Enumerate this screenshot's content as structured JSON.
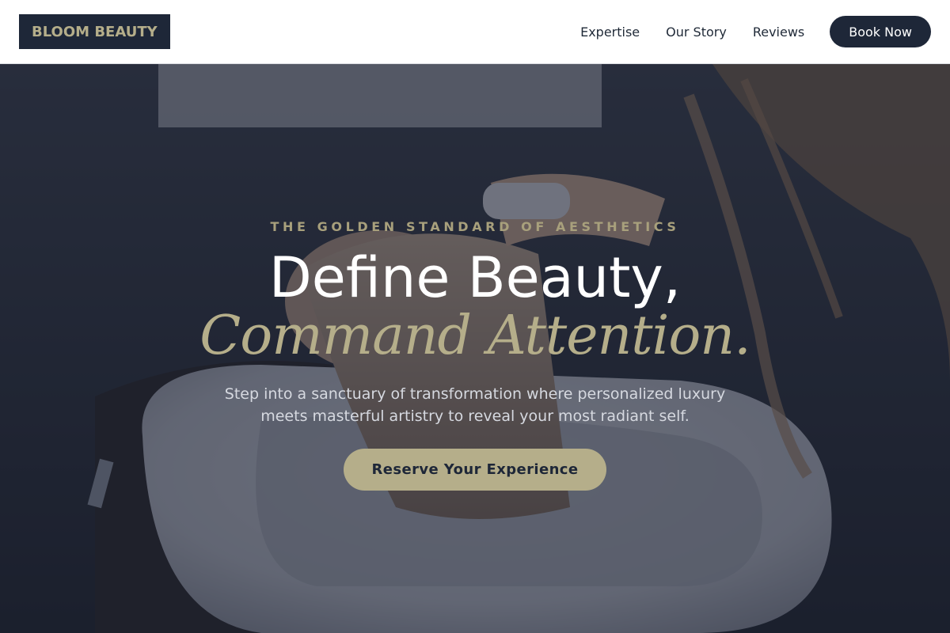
{
  "header": {
    "logo": "BLOOM BEAUTY",
    "nav": [
      {
        "label": "Expertise"
      },
      {
        "label": "Our Story"
      },
      {
        "label": "Reviews"
      }
    ],
    "book_label": "Book Now"
  },
  "hero": {
    "eyebrow": "THE GOLDEN STANDARD OF AESTHETICS",
    "title_line1": "Define Beauty,",
    "title_line2": "Command Attention.",
    "subtitle": "Step into a sanctuary of transformation where personalized luxury meets masterful artistry to reveal your most radiant self.",
    "cta_label": "Reserve Your Experience"
  },
  "colors": {
    "navy": "#1e2738",
    "gold": "#b5ae8a",
    "white": "#ffffff"
  }
}
